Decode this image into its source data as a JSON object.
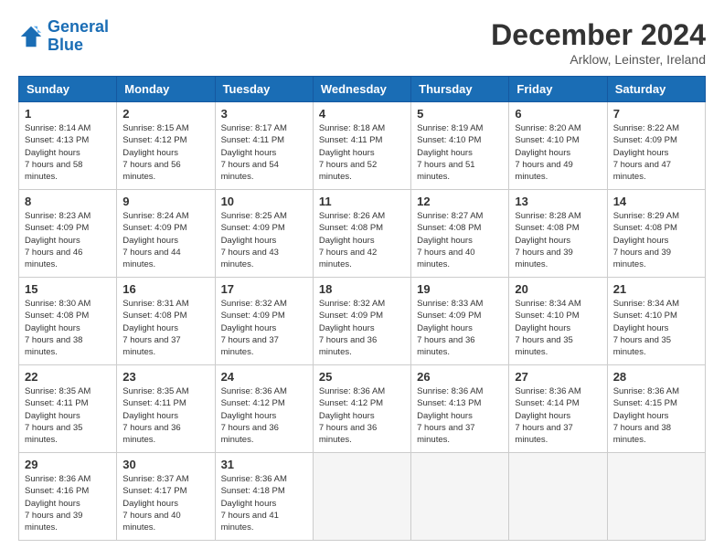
{
  "header": {
    "logo_line1": "General",
    "logo_line2": "Blue",
    "title": "December 2024",
    "subtitle": "Arklow, Leinster, Ireland"
  },
  "days_of_week": [
    "Sunday",
    "Monday",
    "Tuesday",
    "Wednesday",
    "Thursday",
    "Friday",
    "Saturday"
  ],
  "weeks": [
    [
      {
        "day": "1",
        "sunrise": "8:14 AM",
        "sunset": "4:13 PM",
        "daylight": "7 hours and 58 minutes."
      },
      {
        "day": "2",
        "sunrise": "8:15 AM",
        "sunset": "4:12 PM",
        "daylight": "7 hours and 56 minutes."
      },
      {
        "day": "3",
        "sunrise": "8:17 AM",
        "sunset": "4:11 PM",
        "daylight": "7 hours and 54 minutes."
      },
      {
        "day": "4",
        "sunrise": "8:18 AM",
        "sunset": "4:11 PM",
        "daylight": "7 hours and 52 minutes."
      },
      {
        "day": "5",
        "sunrise": "8:19 AM",
        "sunset": "4:10 PM",
        "daylight": "7 hours and 51 minutes."
      },
      {
        "day": "6",
        "sunrise": "8:20 AM",
        "sunset": "4:10 PM",
        "daylight": "7 hours and 49 minutes."
      },
      {
        "day": "7",
        "sunrise": "8:22 AM",
        "sunset": "4:09 PM",
        "daylight": "7 hours and 47 minutes."
      }
    ],
    [
      {
        "day": "8",
        "sunrise": "8:23 AM",
        "sunset": "4:09 PM",
        "daylight": "7 hours and 46 minutes."
      },
      {
        "day": "9",
        "sunrise": "8:24 AM",
        "sunset": "4:09 PM",
        "daylight": "7 hours and 44 minutes."
      },
      {
        "day": "10",
        "sunrise": "8:25 AM",
        "sunset": "4:09 PM",
        "daylight": "7 hours and 43 minutes."
      },
      {
        "day": "11",
        "sunrise": "8:26 AM",
        "sunset": "4:08 PM",
        "daylight": "7 hours and 42 minutes."
      },
      {
        "day": "12",
        "sunrise": "8:27 AM",
        "sunset": "4:08 PM",
        "daylight": "7 hours and 40 minutes."
      },
      {
        "day": "13",
        "sunrise": "8:28 AM",
        "sunset": "4:08 PM",
        "daylight": "7 hours and 39 minutes."
      },
      {
        "day": "14",
        "sunrise": "8:29 AM",
        "sunset": "4:08 PM",
        "daylight": "7 hours and 39 minutes."
      }
    ],
    [
      {
        "day": "15",
        "sunrise": "8:30 AM",
        "sunset": "4:08 PM",
        "daylight": "7 hours and 38 minutes."
      },
      {
        "day": "16",
        "sunrise": "8:31 AM",
        "sunset": "4:08 PM",
        "daylight": "7 hours and 37 minutes."
      },
      {
        "day": "17",
        "sunrise": "8:32 AM",
        "sunset": "4:09 PM",
        "daylight": "7 hours and 37 minutes."
      },
      {
        "day": "18",
        "sunrise": "8:32 AM",
        "sunset": "4:09 PM",
        "daylight": "7 hours and 36 minutes."
      },
      {
        "day": "19",
        "sunrise": "8:33 AM",
        "sunset": "4:09 PM",
        "daylight": "7 hours and 36 minutes."
      },
      {
        "day": "20",
        "sunrise": "8:34 AM",
        "sunset": "4:10 PM",
        "daylight": "7 hours and 35 minutes."
      },
      {
        "day": "21",
        "sunrise": "8:34 AM",
        "sunset": "4:10 PM",
        "daylight": "7 hours and 35 minutes."
      }
    ],
    [
      {
        "day": "22",
        "sunrise": "8:35 AM",
        "sunset": "4:11 PM",
        "daylight": "7 hours and 35 minutes."
      },
      {
        "day": "23",
        "sunrise": "8:35 AM",
        "sunset": "4:11 PM",
        "daylight": "7 hours and 36 minutes."
      },
      {
        "day": "24",
        "sunrise": "8:36 AM",
        "sunset": "4:12 PM",
        "daylight": "7 hours and 36 minutes."
      },
      {
        "day": "25",
        "sunrise": "8:36 AM",
        "sunset": "4:12 PM",
        "daylight": "7 hours and 36 minutes."
      },
      {
        "day": "26",
        "sunrise": "8:36 AM",
        "sunset": "4:13 PM",
        "daylight": "7 hours and 37 minutes."
      },
      {
        "day": "27",
        "sunrise": "8:36 AM",
        "sunset": "4:14 PM",
        "daylight": "7 hours and 37 minutes."
      },
      {
        "day": "28",
        "sunrise": "8:36 AM",
        "sunset": "4:15 PM",
        "daylight": "7 hours and 38 minutes."
      }
    ],
    [
      {
        "day": "29",
        "sunrise": "8:36 AM",
        "sunset": "4:16 PM",
        "daylight": "7 hours and 39 minutes."
      },
      {
        "day": "30",
        "sunrise": "8:37 AM",
        "sunset": "4:17 PM",
        "daylight": "7 hours and 40 minutes."
      },
      {
        "day": "31",
        "sunrise": "8:36 AM",
        "sunset": "4:18 PM",
        "daylight": "7 hours and 41 minutes."
      },
      null,
      null,
      null,
      null
    ]
  ]
}
